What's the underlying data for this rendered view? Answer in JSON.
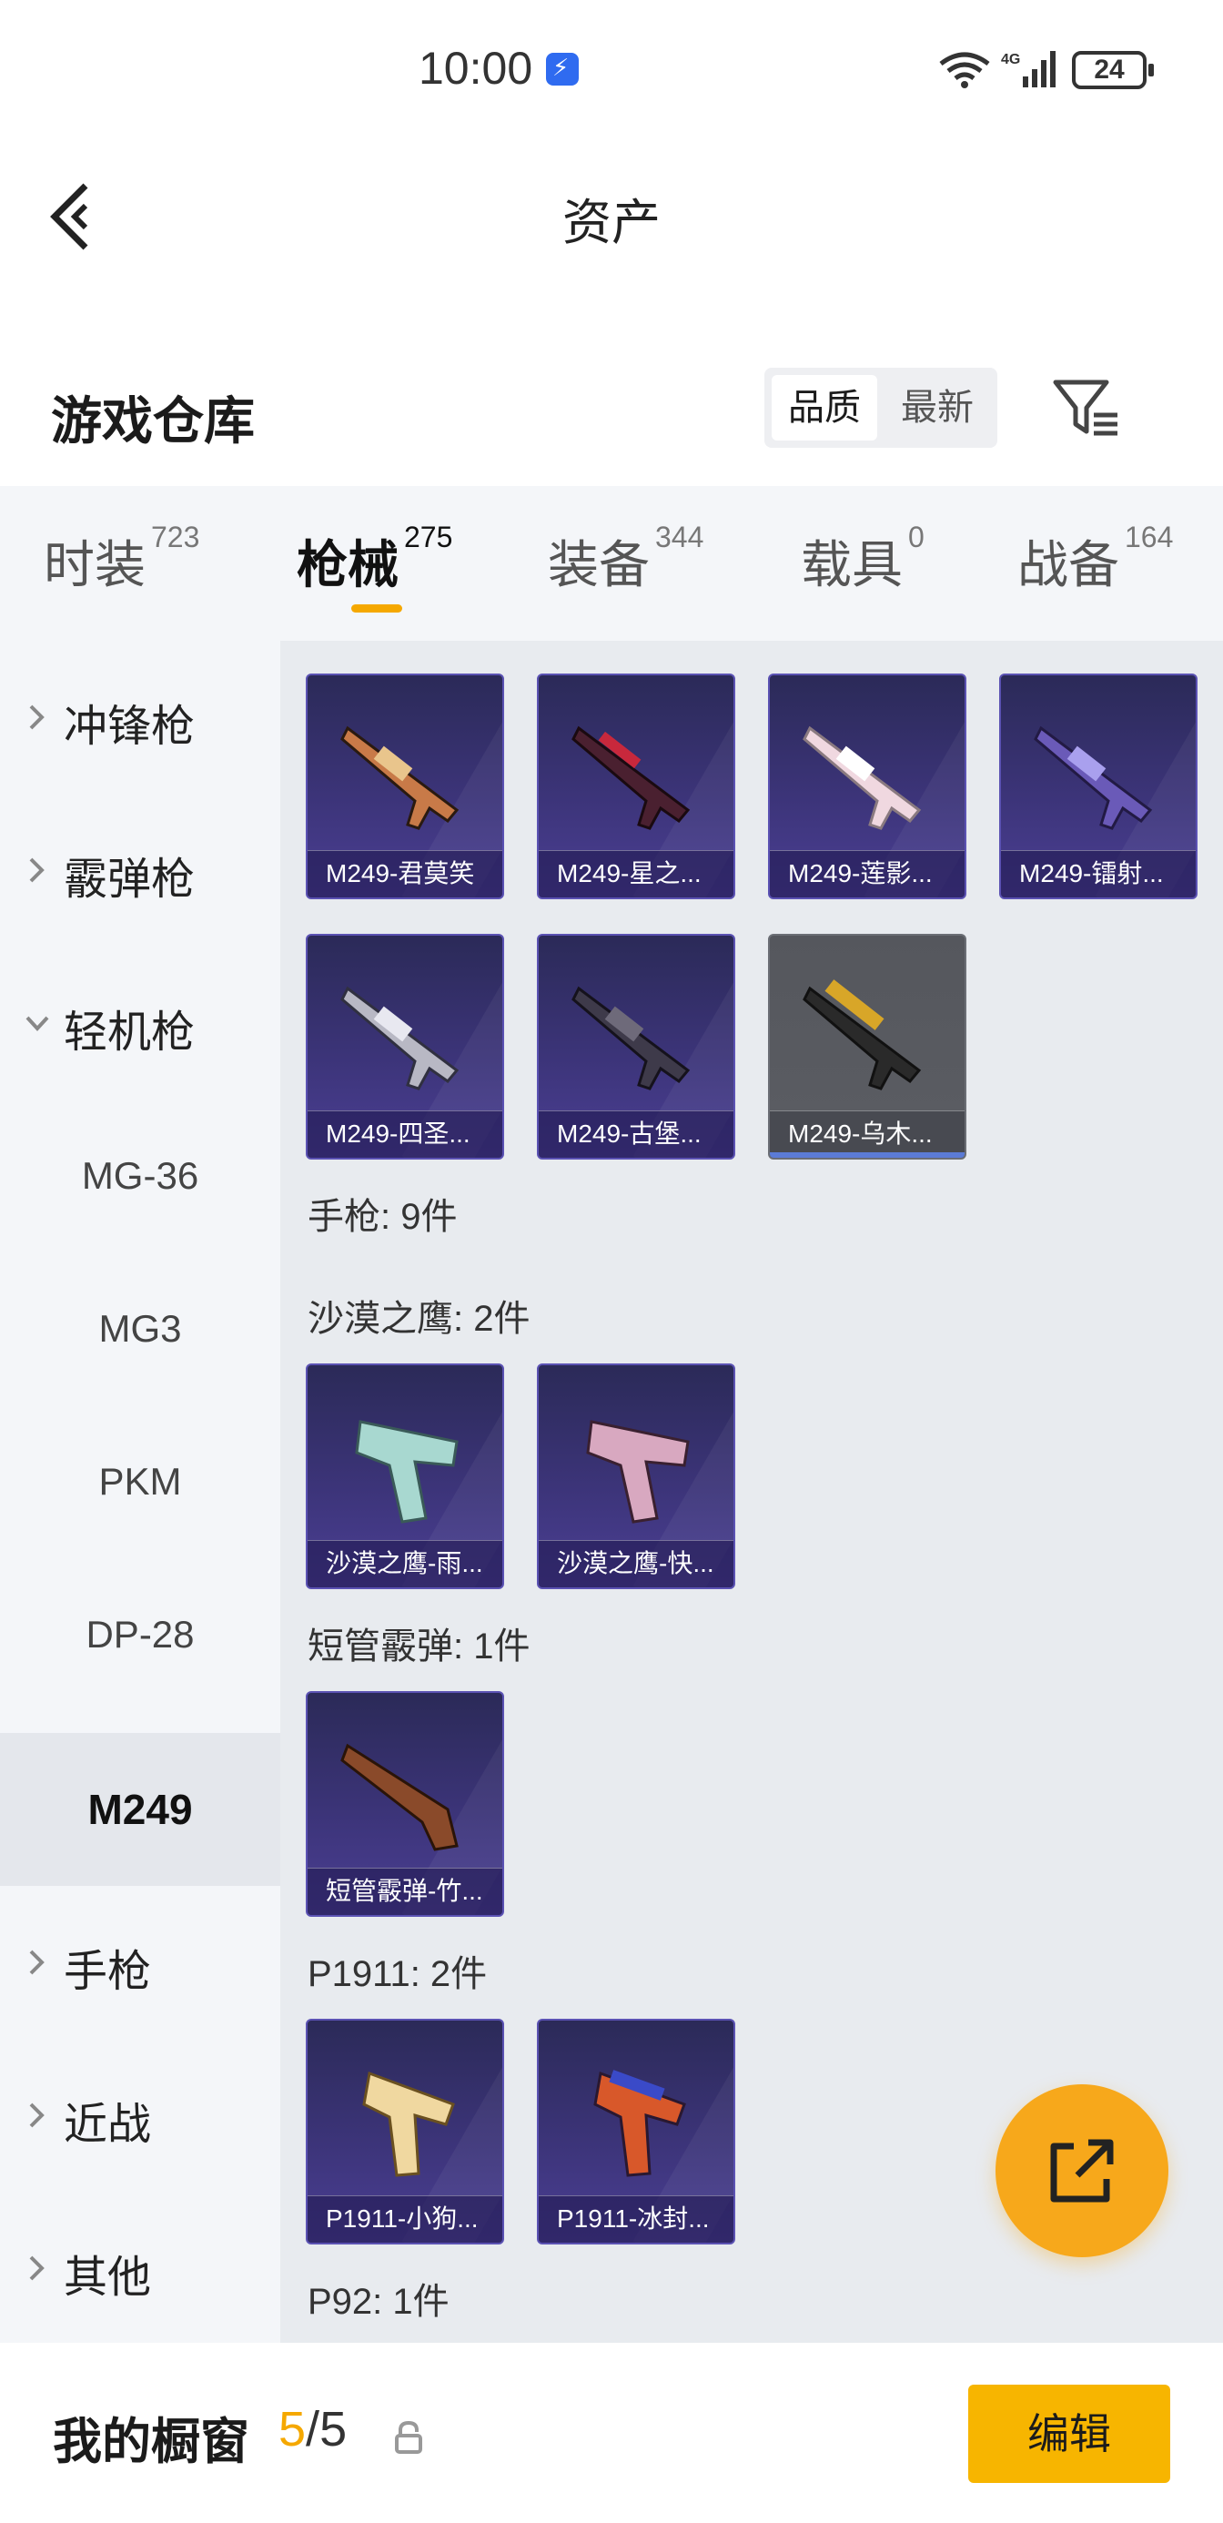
{
  "status_bar": {
    "time": "10:00",
    "battery": "24"
  },
  "header": {
    "title": "资产"
  },
  "warehouse": {
    "title": "游戏仓库",
    "sort_quality": "品质",
    "sort_newest": "最新"
  },
  "category_tabs": [
    {
      "label": "时装",
      "count": "723"
    },
    {
      "label": "枪械",
      "count": "275"
    },
    {
      "label": "装备",
      "count": "344"
    },
    {
      "label": "载具",
      "count": "0"
    },
    {
      "label": "战备",
      "count": "164"
    }
  ],
  "sidebar": {
    "items": [
      {
        "label": "冲锋枪"
      },
      {
        "label": "霰弹枪"
      },
      {
        "label": "轻机枪"
      },
      {
        "label": "MG-36"
      },
      {
        "label": "MG3"
      },
      {
        "label": "PKM"
      },
      {
        "label": "DP-28"
      },
      {
        "label": "M249"
      },
      {
        "label": "手枪"
      },
      {
        "label": "近战"
      },
      {
        "label": "其他"
      }
    ]
  },
  "content": {
    "m249_cards": [
      "M249-君莫笑",
      "M249-星之...",
      "M249-莲影...",
      "M249-镭射...",
      "M249-四圣...",
      "M249-古堡...",
      "M249-乌木..."
    ],
    "section_pistol": "手枪: 9件",
    "section_deagle": "沙漠之鹰: 2件",
    "deagle_cards": [
      "沙漠之鹰-雨...",
      "沙漠之鹰-快..."
    ],
    "section_shortshotgun": "短管霰弹: 1件",
    "shortshotgun_cards": [
      "短管霰弹-竹..."
    ],
    "section_p1911": "P1911: 2件",
    "p1911_cards": [
      "P1911-小狗...",
      "P1911-冰封..."
    ],
    "section_p92": "P92: 1件"
  },
  "bottom_bar": {
    "showcase_label": "我的橱窗",
    "showcase_current": "5",
    "showcase_sep": "/",
    "showcase_total": "5",
    "edit_label": "编辑"
  },
  "colors": {
    "accent": "#f7b500",
    "card_purple": "#3c3479",
    "tab_indicator": "#f5a800"
  },
  "icons": [
    "back-arrow-icon",
    "filter-icon",
    "chevron-right-icon",
    "chevron-down-icon",
    "share-icon",
    "lock-icon",
    "wifi-icon",
    "signal-icon",
    "battery-icon",
    "boost-icon"
  ]
}
